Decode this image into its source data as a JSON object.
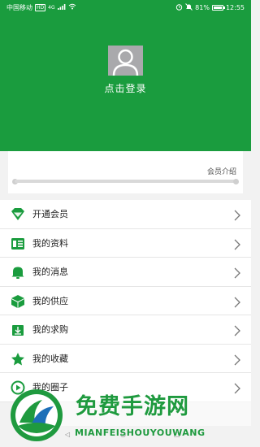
{
  "status_bar": {
    "carrier": "中国移动",
    "hd_badge": "HD",
    "network": "4G",
    "battery": "81%",
    "battery_level": 0.81,
    "time": "12:55"
  },
  "header": {
    "login_label": "点击登录"
  },
  "member": {
    "intro_link": "会员介绍"
  },
  "menu": [
    {
      "label": "开通会员",
      "icon": "diamond-icon"
    },
    {
      "label": "我的资料",
      "icon": "profile-card-icon"
    },
    {
      "label": "我的消息",
      "icon": "bell-icon"
    },
    {
      "label": "我的供应",
      "icon": "box-icon"
    },
    {
      "label": "我的求购",
      "icon": "cart-icon"
    },
    {
      "label": "我的收藏",
      "icon": "star-icon"
    },
    {
      "label": "我的圈子",
      "icon": "circle-icon"
    }
  ],
  "watermark": {
    "title": "免费手游网",
    "subtitle": "MIANFEISHOUYOUWANG"
  },
  "colors": {
    "brand_green": "#1a9c3e",
    "avatar_gray": "#a9a9ac",
    "divider": "#e6e6e6"
  }
}
